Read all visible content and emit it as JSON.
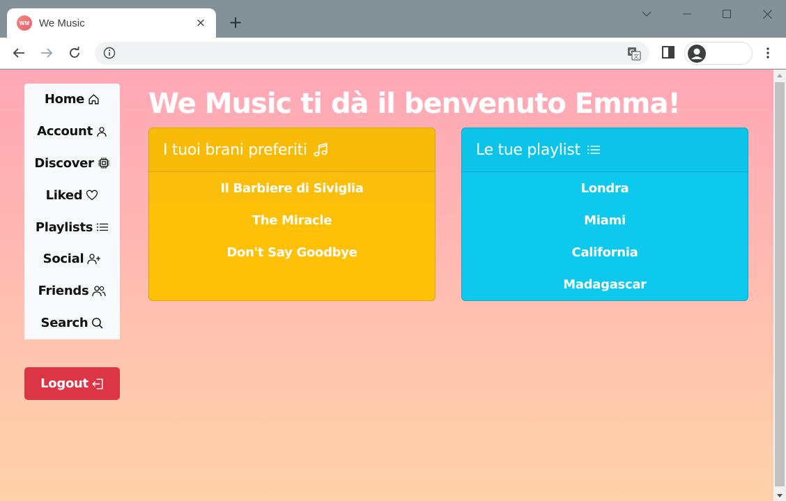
{
  "browser": {
    "tab_title": "We Music",
    "favicon_text": "WM",
    "tab_close": "×",
    "new_tab": "+",
    "window_controls": [
      "chevron-down",
      "minimize",
      "maximize",
      "close"
    ],
    "address": ""
  },
  "sidebar": {
    "items": [
      {
        "label": "Home",
        "icon": "house-icon"
      },
      {
        "label": "Account",
        "icon": "person-icon"
      },
      {
        "label": "Discover",
        "icon": "cpu-icon"
      },
      {
        "label": "Liked",
        "icon": "heart-icon"
      },
      {
        "label": "Playlists",
        "icon": "list-icon"
      },
      {
        "label": "Social",
        "icon": "person-plus-icon"
      },
      {
        "label": "Friends",
        "icon": "people-icon"
      },
      {
        "label": "Search",
        "icon": "search-icon"
      }
    ],
    "logout_label": "Logout"
  },
  "main": {
    "welcome": "We Music ti dà il benvenuto Emma!",
    "favorites": {
      "title": "I tuoi brani preferiti",
      "icon": "music-note-icon",
      "items": [
        "Il Barbiere di Siviglia",
        "The Miracle",
        "Don't Say Goodbye"
      ]
    },
    "playlists": {
      "title": "Le tue playlist",
      "icon": "list-icon",
      "items": [
        "Londra",
        "Miami",
        "California",
        "Madagascar"
      ]
    }
  },
  "colors": {
    "sidebar_bg": "#f8f9fa",
    "logout": "#dc3545",
    "favorites_card": "#fec107",
    "playlists_card": "#0dc9ee",
    "page_gradient_top": "#ffa8b6",
    "page_gradient_bottom": "#ffd2aa"
  }
}
